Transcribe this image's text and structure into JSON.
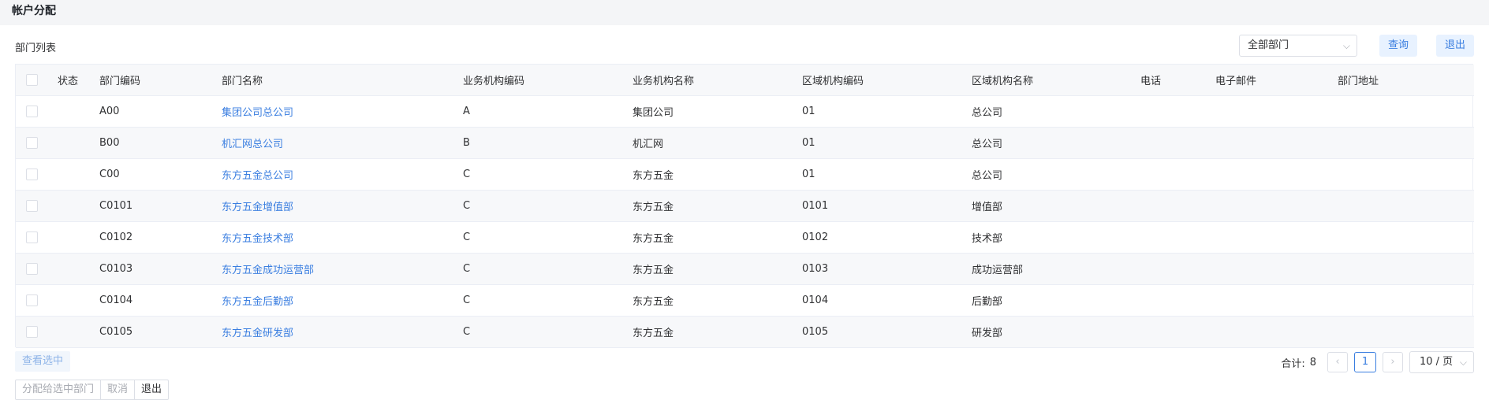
{
  "header": {
    "title": "帐户分配"
  },
  "toolbar": {
    "title": "部门列表",
    "select_value": "全部部门",
    "query_label": "查询",
    "exit_label": "退出"
  },
  "table": {
    "columns": [
      "状态",
      "部门编码",
      "部门名称",
      "业务机构编码",
      "业务机构名称",
      "区域机构编码",
      "区域机构名称",
      "电话",
      "电子邮件",
      "部门地址"
    ],
    "rows": [
      {
        "code": "A00",
        "name": "集团公司总公司",
        "biz_code": "A",
        "biz_name": "集团公司",
        "region_code": "01",
        "region_name": "总公司"
      },
      {
        "code": "B00",
        "name": "机汇网总公司",
        "biz_code": "B",
        "biz_name": "机汇网",
        "region_code": "01",
        "region_name": "总公司"
      },
      {
        "code": "C00",
        "name": "东方五金总公司",
        "biz_code": "C",
        "biz_name": "东方五金",
        "region_code": "01",
        "region_name": "总公司"
      },
      {
        "code": "C0101",
        "name": "东方五金增值部",
        "biz_code": "C",
        "biz_name": "东方五金",
        "region_code": "0101",
        "region_name": "增值部"
      },
      {
        "code": "C0102",
        "name": "东方五金技术部",
        "biz_code": "C",
        "biz_name": "东方五金",
        "region_code": "0102",
        "region_name": "技术部"
      },
      {
        "code": "C0103",
        "name": "东方五金成功运营部",
        "biz_code": "C",
        "biz_name": "东方五金",
        "region_code": "0103",
        "region_name": "成功运营部"
      },
      {
        "code": "C0104",
        "name": "东方五金后勤部",
        "biz_code": "C",
        "biz_name": "东方五金",
        "region_code": "0104",
        "region_name": "后勤部"
      },
      {
        "code": "C0105",
        "name": "东方五金研发部",
        "biz_code": "C",
        "biz_name": "东方五金",
        "region_code": "0105",
        "region_name": "研发部"
      }
    ]
  },
  "footer": {
    "view_selected_label": "查看选中",
    "assign_label": "分配给选中部门",
    "cancel_label": "取消",
    "exit_label": "退出"
  },
  "pagination": {
    "total_label": "合计:",
    "total": "8",
    "prev_icon": "‹",
    "current_page": "1",
    "next_icon": "›",
    "page_size": "10 / 页"
  },
  "icons": {
    "select_chevron": "chevron-down-icon",
    "page_size_chevron": "chevron-down-icon"
  },
  "colors": {
    "accent": "#3a7ee0",
    "row_stripe": "#f7f8fa",
    "border": "#ebeef5"
  }
}
